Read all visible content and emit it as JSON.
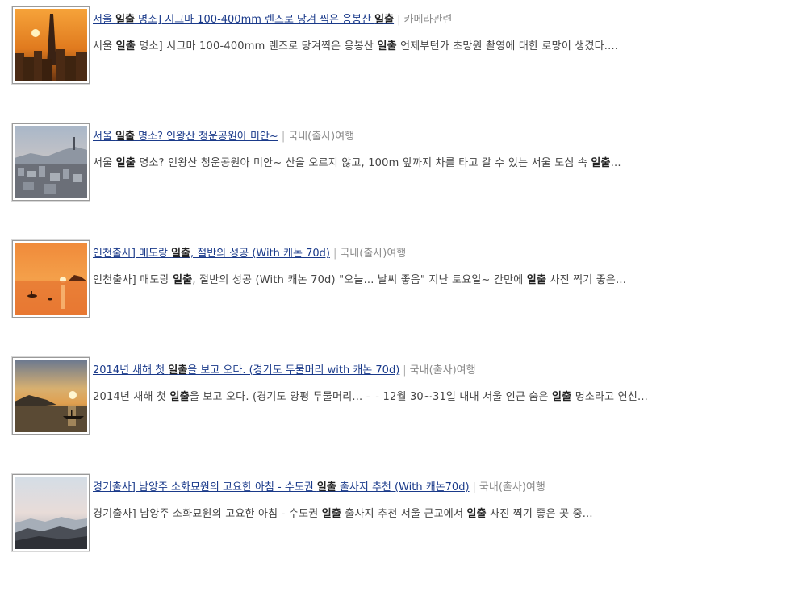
{
  "results": [
    {
      "title_parts": [
        "서울 ",
        "일출",
        " 명소] 시그마 100-400mm 렌즈로 당겨 찍은 응봉산 ",
        "일출"
      ],
      "separator": "|",
      "category": "카메라관련",
      "snippet_parts": [
        "서울 ",
        "일출",
        " 명소] 시그마 100-400mm 렌즈로 당겨찍은 응봉산 ",
        "일출",
        " 언제부턴가 초망원 촬영에 대한 로망이 생겼다...."
      ],
      "thumbnail": "sunset-city-skyline"
    },
    {
      "title_parts": [
        "서울 ",
        "일출",
        " 명소? 인왕산 청운공원아 미안~"
      ],
      "separator": "|",
      "category": "국내(출사)여행",
      "snippet_parts": [
        "서울 ",
        "일출",
        " 명소? 인왕산 청운공원아 미안~ 산을 오르지 않고, 100m 앞까지 차를 타고 갈 수 있는 서울 도심 속 ",
        "일출",
        "..."
      ],
      "thumbnail": "hazy-city-dawn"
    },
    {
      "title_parts": [
        "인천출사] 매도랑 ",
        "일출",
        ", 절반의 성공 (With 캐논 70d)"
      ],
      "separator": "|",
      "category": "국내(출사)여행",
      "snippet_parts": [
        "인천출사] 매도랑 ",
        "일출",
        ", 절반의 성공 (With 캐논 70d) \"오늘... 날씨 좋음\" 지난 토요일~ 간만에 ",
        "일출",
        " 사진 찍기 좋은..."
      ],
      "thumbnail": "orange-sea-sunrise"
    },
    {
      "title_parts": [
        "2014년 새해 첫 ",
        "일출",
        "을 보고 오다. (경기도 두물머리 with 캐논 70d)"
      ],
      "separator": "|",
      "category": "국내(출사)여행",
      "snippet_parts": [
        "2014년 새해 첫 ",
        "일출",
        "을 보고 오다. (경기도 양평 두물머리... -_- 12월 30~31일 내내 서울 인근 숨은 ",
        "일출",
        " 명소라고 연신..."
      ],
      "thumbnail": "river-boat-sunrise"
    },
    {
      "title_parts": [
        "경기출사] 남양주 소화묘원의 고요한 아침 - 수도권 ",
        "일출",
        " 출사지 추천 (With 캐논70d)"
      ],
      "separator": "|",
      "category": "국내(출사)여행",
      "snippet_parts": [
        "경기출사] 남양주 소화묘원의 고요한 아침 - 수도권 ",
        "일출",
        " 출사지 추천 서울 근교에서 ",
        "일출",
        " 사진 찍기 좋은 곳 중..."
      ],
      "thumbnail": "misty-mountain-morning"
    }
  ]
}
